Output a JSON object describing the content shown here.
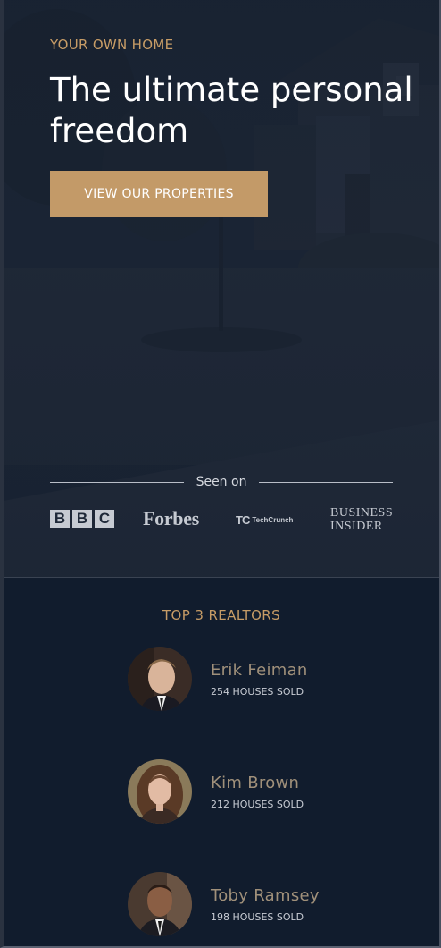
{
  "hero": {
    "eyebrow": "YOUR OWN HOME",
    "headline": "The ultimate personal freedom",
    "cta_label": "VIEW OUR PROPERTIES"
  },
  "press": {
    "label": "Seen on",
    "logos": {
      "bbc": [
        "B",
        "B",
        "C"
      ],
      "forbes": "Forbes",
      "techcrunch_mark": "TC",
      "techcrunch_word": "TechCrunch",
      "business_insider_line1": "BUSINESS",
      "business_insider_line2": "INSIDER"
    }
  },
  "realtors": {
    "title": "TOP 3 REALTORS",
    "items": [
      {
        "name": "Erik Feiman",
        "sold": "254 HOUSES SOLD"
      },
      {
        "name": "Kim Brown",
        "sold": "212 HOUSES SOLD"
      },
      {
        "name": "Toby Ramsey",
        "sold": "198 HOUSES SOLD"
      }
    ]
  },
  "colors": {
    "accent": "#c79c66",
    "button": "#c39a68",
    "navy": "#111c2d",
    "name_text": "#a0907a"
  }
}
